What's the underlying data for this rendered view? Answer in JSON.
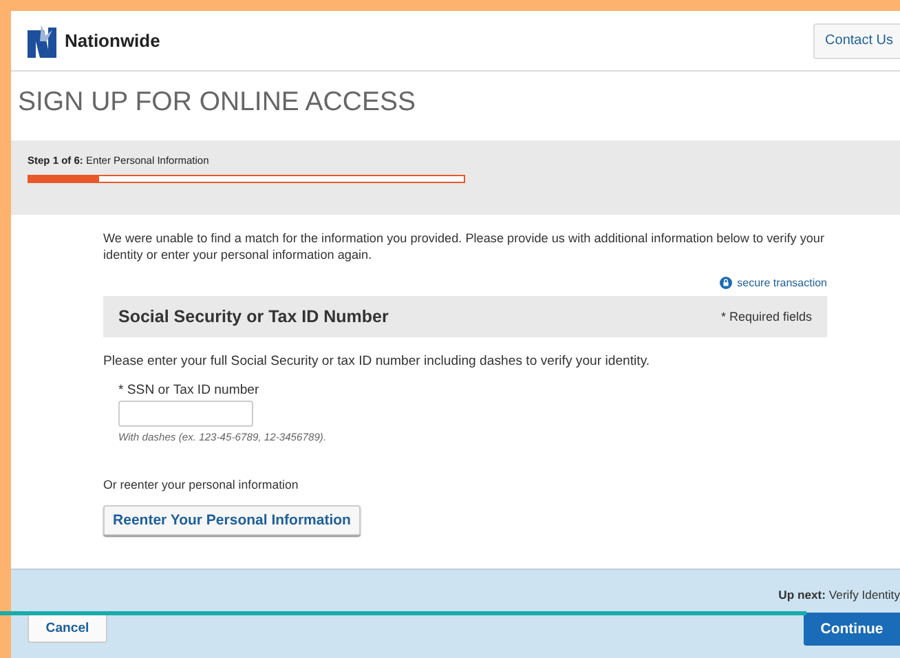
{
  "header": {
    "brand": "Nationwide",
    "contact_button": "Contact Us"
  },
  "title": "SIGN UP FOR ONLINE ACCESS",
  "step": {
    "label": "**Step 1 of 6:** Enter Personal Information",
    "level": 0.16
  },
  "message": "We were unable to find a match for the information you provided. Please provide us with additional information below to verify your identity or enter your personal information again.",
  "secure_note": "secure transaction",
  "section": {
    "title": "Social Security or Tax ID Number",
    "required_note": "* Required fields"
  },
  "instruction": "Please enter your full Social Security or tax ID number including dashes to verify your identity.",
  "ssn_field": {
    "label": "* SSN or Tax ID number",
    "hint": "With dashes (ex. 123-45-6789, 12-3456789)."
  },
  "reenter_prompt": "Or reenter your personal information",
  "reenter_button": "Reenter Your Personal Information",
  "footer": {
    "up_next": "**Up next:** Verify Identity",
    "cancel_button": "Cancel",
    "continue_button": "Continue"
  }
}
